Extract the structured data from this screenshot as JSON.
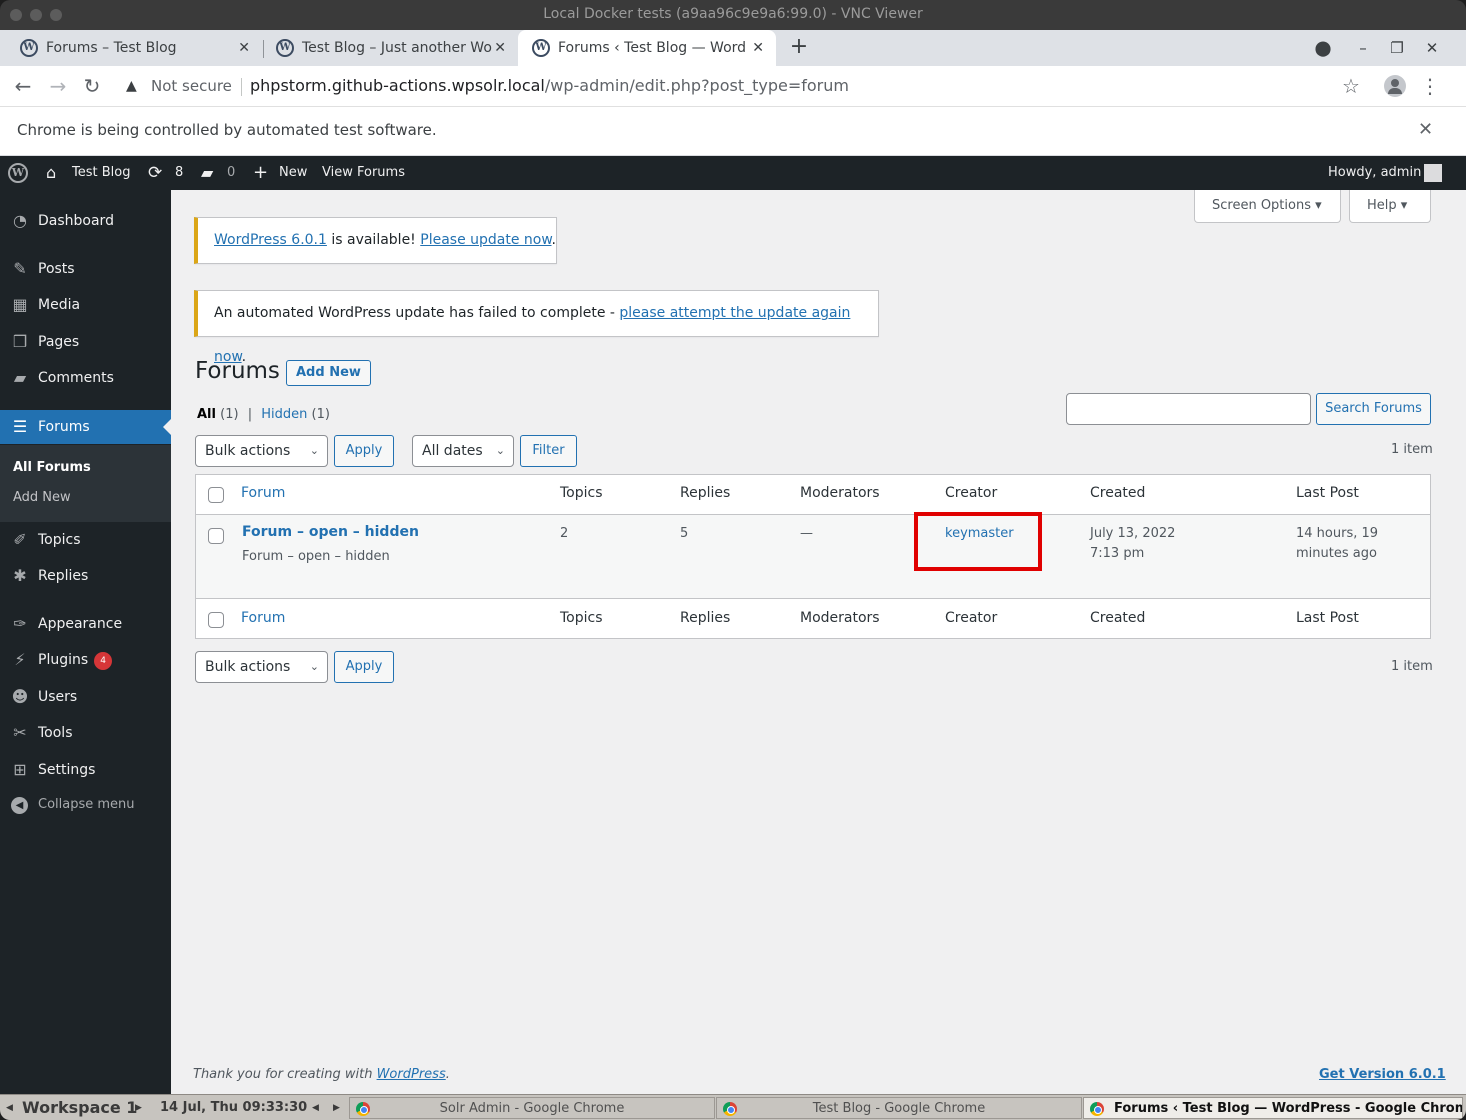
{
  "vnc": {
    "title": "Local Docker tests (a9aa96c9e9a6:99.0) - VNC Viewer"
  },
  "browser": {
    "tabs": [
      {
        "label": "Forums – Test Blog"
      },
      {
        "label": "Test Blog – Just another Wo"
      },
      {
        "label": "Forums ‹ Test Blog — Word"
      }
    ],
    "not_secure": "Not secure",
    "url_host": "phpstorm.github-actions.wpsolr.local",
    "url_path": "/wp-admin/edit.php?post_type=forum",
    "infobar": "Chrome is being controlled by automated test software."
  },
  "adminbar": {
    "site_name": "Test Blog",
    "updates_count": "8",
    "comments_count": "0",
    "new_label": "New",
    "view_label": "View Forums",
    "howdy": "Howdy, admin"
  },
  "sidebar": {
    "items": [
      {
        "label": "Dashboard"
      },
      {
        "label": "Posts"
      },
      {
        "label": "Media"
      },
      {
        "label": "Pages"
      },
      {
        "label": "Comments"
      },
      {
        "label": "Forums"
      },
      {
        "label": "Topics"
      },
      {
        "label": "Replies"
      },
      {
        "label": "Appearance"
      },
      {
        "label": "Plugins",
        "badge": "4"
      },
      {
        "label": "Users"
      },
      {
        "label": "Tools"
      },
      {
        "label": "Settings"
      }
    ],
    "submenu": [
      {
        "label": "All Forums"
      },
      {
        "label": "Add New"
      }
    ],
    "collapse": "Collapse menu"
  },
  "screen_options": {
    "screen_options": "Screen Options",
    "help": "Help"
  },
  "notices": {
    "update": {
      "version_link": "WordPress 6.0.1",
      "middle": " is available! ",
      "update_link": "Please update now",
      "end": "."
    },
    "failed": {
      "text": "An automated WordPress update has failed to complete - ",
      "link": "please attempt the update again now",
      "end": "."
    }
  },
  "page": {
    "title": "Forums",
    "add_new": "Add New"
  },
  "views": {
    "all": "All",
    "all_count": "(1)",
    "sep": "|",
    "hidden": "Hidden",
    "hidden_count": "(1)"
  },
  "search": {
    "button": "Search Forums",
    "value": ""
  },
  "filters": {
    "bulk_actions": "Bulk actions",
    "apply": "Apply",
    "dates": "All dates",
    "filter": "Filter",
    "item_count": "1 item"
  },
  "table": {
    "columns": [
      "Forum",
      "Topics",
      "Replies",
      "Moderators",
      "Creator",
      "Created",
      "Last Post"
    ],
    "rows": [
      {
        "title": "Forum – open – hidden",
        "excerpt": "Forum – open – hidden",
        "topics": "2",
        "replies": "5",
        "moderators": "—",
        "creator": "keymaster",
        "created_date": "July 13, 2022",
        "created_time": "7:13 pm",
        "last_post_1": "14 hours, 19",
        "last_post_2": "minutes ago"
      }
    ]
  },
  "footer": {
    "thanks": "Thank you for creating with ",
    "wp_link": "WordPress",
    "period": ".",
    "version": "Get Version 6.0.1"
  },
  "taskbar": {
    "workspace": "Workspace 1",
    "clock": "14 Jul, Thu 09:33:30",
    "tasks": [
      {
        "label": "Solr Admin - Google Chrome"
      },
      {
        "label": "Test Blog - Google Chrome"
      },
      {
        "label": "Forums ‹ Test Blog — WordPress - Google Chrom"
      }
    ]
  },
  "colors": {
    "wp_blue": "#2271b1",
    "admin_dark": "#1d2327",
    "notice_warning": "#dba617",
    "highlight_red": "#e00000"
  }
}
